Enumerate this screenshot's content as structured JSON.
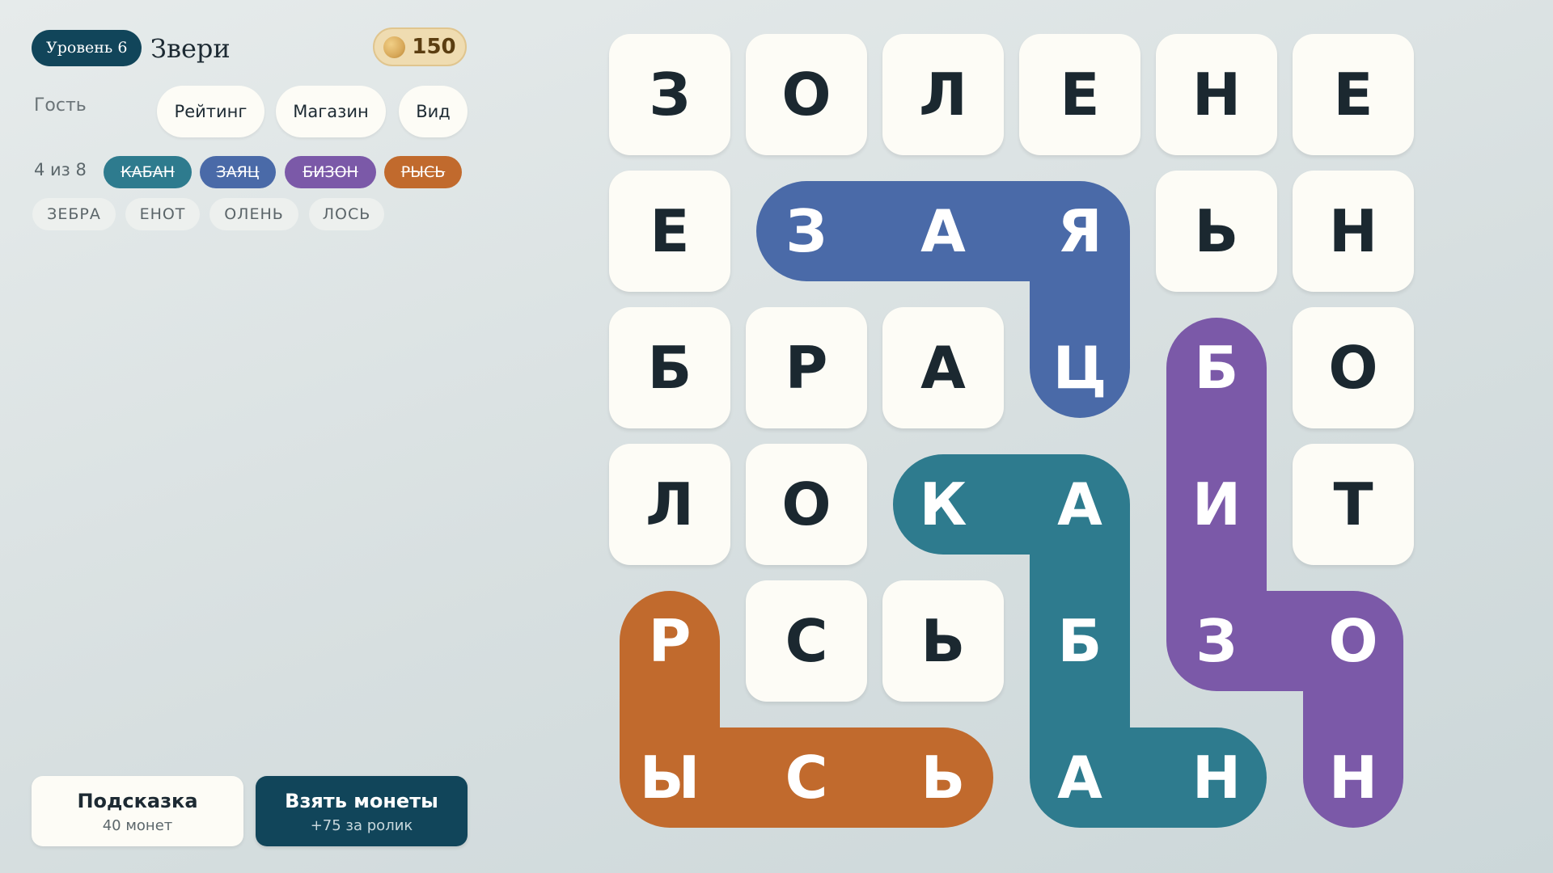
{
  "header": {
    "level_label": "Уровень 6",
    "theme_title": "Звери",
    "coins": "150"
  },
  "nav": {
    "guest_label": "Гость",
    "rating_button": "Рейтинг",
    "shop_button": "Магазин",
    "view_button": "Вид"
  },
  "words": {
    "progress": "4 из 8",
    "found": [
      {
        "word": "КАБАН",
        "color": "#2e7b8e"
      },
      {
        "word": "ЗАЯЦ",
        "color": "#4a6aa8"
      },
      {
        "word": "БИЗОН",
        "color": "#7b59a8"
      },
      {
        "word": "РЫСЬ",
        "color": "#c16a2d"
      }
    ],
    "remaining": [
      "ЗЕБРА",
      "ЕНОТ",
      "ОЛЕНЬ",
      "ЛОСЬ"
    ]
  },
  "actions": {
    "hint_label": "Подсказка",
    "hint_cost": "40 монет",
    "coins_label": "Взять монеты",
    "coins_reward": "+75 за ролик"
  },
  "grid": {
    "rows": [
      [
        "З",
        "О",
        "Л",
        "Е",
        "Н",
        "Е"
      ],
      [
        "Е",
        "З",
        "А",
        "Я",
        "Ь",
        "Н"
      ],
      [
        "Б",
        "Р",
        "А",
        "Ц",
        "Б",
        "О"
      ],
      [
        "Л",
        "О",
        "К",
        "А",
        "И",
        "Т"
      ],
      [
        "Р",
        "С",
        "Ь",
        "Б",
        "З",
        "О"
      ],
      [
        "Ы",
        "С",
        "Ь",
        "А",
        "Н",
        "Н"
      ]
    ],
    "paths": [
      {
        "word": "ЗАЯЦ",
        "color": "#4a6aa8",
        "cells": [
          [
            1,
            1
          ],
          [
            1,
            2
          ],
          [
            1,
            3
          ],
          [
            2,
            3
          ]
        ]
      },
      {
        "word": "КАБАН",
        "color": "#2e7b8e",
        "cells": [
          [
            3,
            2
          ],
          [
            3,
            3
          ],
          [
            4,
            3
          ],
          [
            5,
            3
          ],
          [
            5,
            4
          ]
        ]
      },
      {
        "word": "БИЗОН",
        "color": "#7b59a8",
        "cells": [
          [
            2,
            4
          ],
          [
            3,
            4
          ],
          [
            4,
            4
          ],
          [
            4,
            5
          ],
          [
            5,
            5
          ]
        ]
      },
      {
        "word": "РЫСЬ",
        "color": "#c16a2d",
        "cells": [
          [
            4,
            0
          ],
          [
            5,
            0
          ],
          [
            5,
            1
          ],
          [
            5,
            2
          ]
        ]
      }
    ]
  }
}
